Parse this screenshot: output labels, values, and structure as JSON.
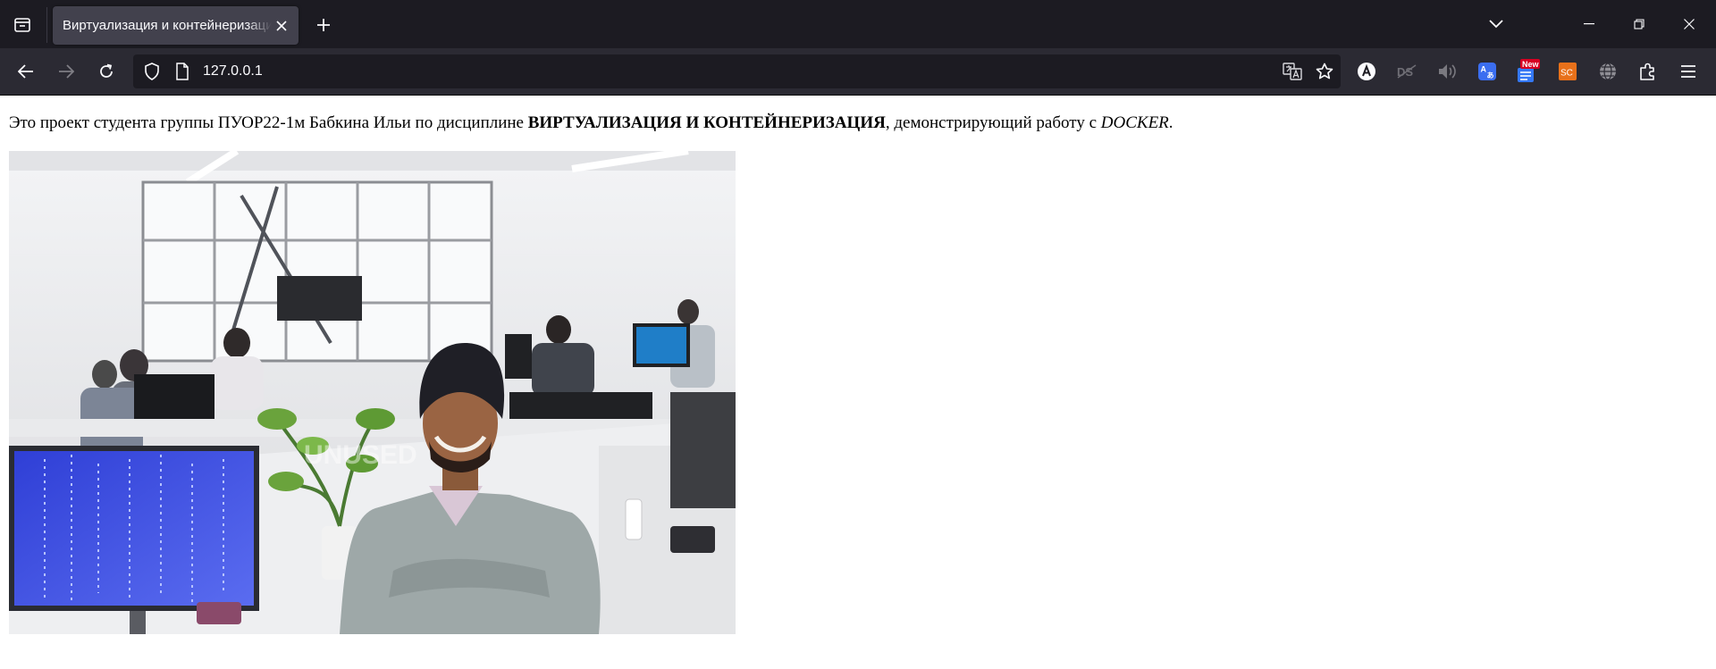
{
  "browser": {
    "tab": {
      "title": "Виртуализация и контейнеризация"
    },
    "address": {
      "url": "127.0.0.1"
    },
    "extensions": {
      "badge_new": "New",
      "badge_sc": "SC"
    }
  },
  "page": {
    "intro": {
      "part1": "Это проект студента группы ПУОР22-1м Бабкина Ильи по дисциплине ",
      "bold": "ВИРТУАЛИЗАЦИЯ И КОНТЕЙНЕРИЗАЦИЯ",
      "part2": ", демонстрирующий работу с ",
      "italic": "DOCKER",
      "part3": "."
    },
    "image": {
      "watermark": "UNUSED"
    }
  },
  "colors": {
    "chrome_dark": "#1c1b22",
    "toolbar": "#2b2a33",
    "tab_active": "#42414d",
    "icon": "#fbfbfe",
    "sc_orange": "#e8711a",
    "new_red": "#d70022"
  }
}
